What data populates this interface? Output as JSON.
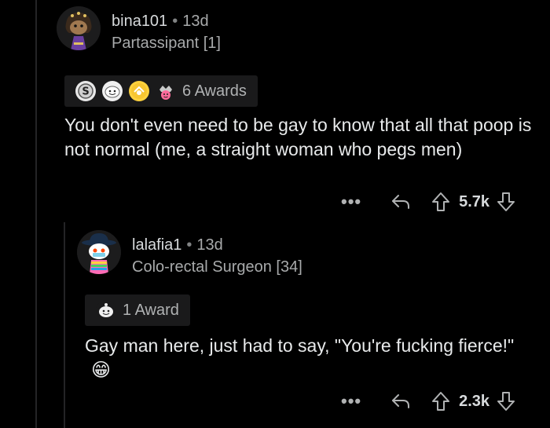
{
  "comment1": {
    "username": "bina101",
    "age": "13d",
    "flair": "Partassipant [1]",
    "awards_label": "6 Awards",
    "body": "You don't even need to be gay to know that all that poop is not normal (me, a straight woman who pegs men)",
    "more": "•••",
    "score": "5.7k"
  },
  "comment2": {
    "username": "lalafia1",
    "age": "13d",
    "flair": "Colo-rectal Surgeon [34]",
    "awards_label": "1 Award",
    "body": "Gay man here, just had to say, \"You're fucking fierce!\"",
    "emoji": "😁",
    "more": "•••",
    "score": "2.3k"
  },
  "separator": "•",
  "icons": {
    "reply": "reply-icon",
    "upvote": "upvote-arrow-icon",
    "downvote": "downvote-arrow-icon",
    "more": "more-dots-icon"
  },
  "colors": {
    "background": "#000000",
    "text": "#d7dadc",
    "muted": "#a8aaab",
    "award_bg": "#1a1a1b"
  }
}
